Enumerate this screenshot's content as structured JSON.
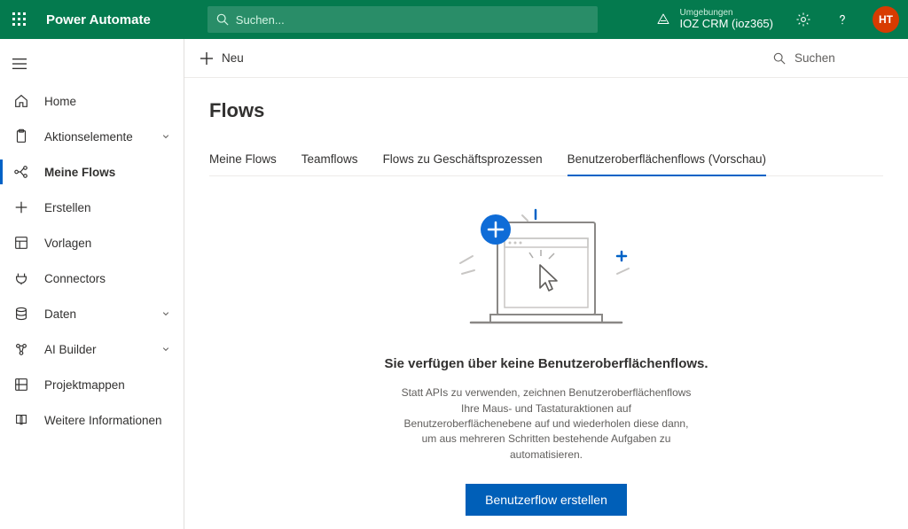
{
  "header": {
    "brand": "Power Automate",
    "search_placeholder": "Suchen...",
    "env_label": "Umgebungen",
    "env_name": "IOZ CRM (ioz365)",
    "avatar_initials": "HT"
  },
  "sidebar": {
    "items": [
      {
        "label": "Home",
        "icon": "home-icon",
        "chevron": false,
        "active": false
      },
      {
        "label": "Aktionselemente",
        "icon": "clipboard-icon",
        "chevron": true,
        "active": false
      },
      {
        "label": "Meine Flows",
        "icon": "flow-icon",
        "chevron": false,
        "active": true
      },
      {
        "label": "Erstellen",
        "icon": "plus-icon",
        "chevron": false,
        "active": false
      },
      {
        "label": "Vorlagen",
        "icon": "templates-icon",
        "chevron": false,
        "active": false
      },
      {
        "label": "Connectors",
        "icon": "connector-icon",
        "chevron": false,
        "active": false
      },
      {
        "label": "Daten",
        "icon": "data-icon",
        "chevron": true,
        "active": false
      },
      {
        "label": "AI Builder",
        "icon": "ai-icon",
        "chevron": true,
        "active": false
      },
      {
        "label": "Projektmappen",
        "icon": "solutions-icon",
        "chevron": false,
        "active": false
      },
      {
        "label": "Weitere Informationen",
        "icon": "book-icon",
        "chevron": false,
        "active": false
      }
    ]
  },
  "commandbar": {
    "new_label": "Neu",
    "search_placeholder": "Suchen"
  },
  "page": {
    "title": "Flows",
    "tabs": [
      {
        "label": "Meine Flows",
        "active": false
      },
      {
        "label": "Teamflows",
        "active": false
      },
      {
        "label": "Flows zu Geschäftsprozessen",
        "active": false
      },
      {
        "label": "Benutzeroberflächenflows (Vorschau)",
        "active": true
      }
    ],
    "empty_title": "Sie verfügen über keine Benutzeroberflächenflows.",
    "empty_body": "Statt APIs zu verwenden, zeichnen Benutzeroberflächenflows Ihre Maus- und Tastaturaktionen auf Benutzeroberflächenebene auf und wiederholen diese dann, um aus mehreren Schritten bestehende Aufgaben zu automatisieren.",
    "cta_label": "Benutzerflow erstellen"
  }
}
